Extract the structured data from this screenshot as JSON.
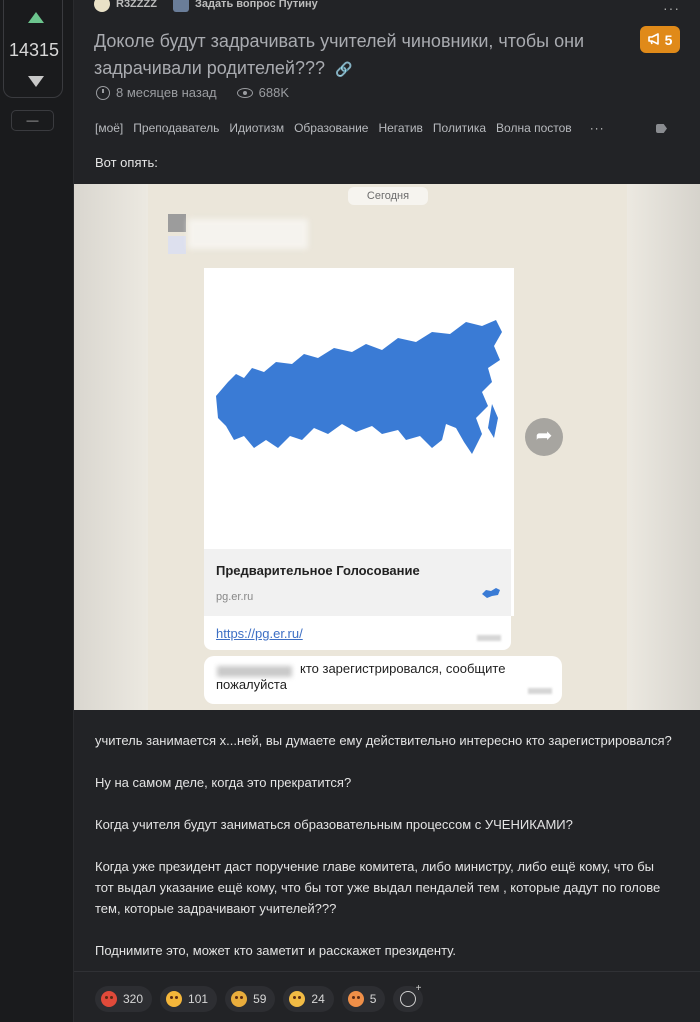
{
  "vote": {
    "count": "14315",
    "mini_label": "—"
  },
  "header": {
    "author": "R3ZZZZ",
    "community": "Задать вопрос Путину",
    "more": "···"
  },
  "badge": {
    "count": "5",
    "color": "#e08a19"
  },
  "post": {
    "title": "Доколе будут задрачивать учителей чиновники, чтобы они задрачивали родителей???",
    "time": "8 месяцев назад",
    "views": "688K",
    "tags": [
      "[моё]",
      "Преподаватель",
      "Идиотизм",
      "Образование",
      "Негатив",
      "Политика",
      "Волна постов"
    ],
    "tags_more": "···",
    "intro": "Вот опять:"
  },
  "screenshot": {
    "day_label": "Сегодня",
    "preview_title": "Предварительное Голосование",
    "preview_site": "pg.er.ru",
    "link": "https://pg.er.ru/",
    "message": "кто зарегистрировался, сообщите пожалуйста",
    "map_color": "#3a7bd5"
  },
  "body": [
    "учитель занимается х...ней, вы думаете ему действительно интересно кто зарегистрировался?",
    "Ну на самом деле, когда это прекратится?",
    "Когда учителя будут заниматься образовательным процессом с УЧЕНИКАМИ?",
    "Когда уже президент даст поручение главе комитета, либо министру, либо ещё кому, что бы тот выдал указание ещё кому, что бы тот уже выдал пендалей тем , которые дадут по голове тем, которые задрачивают учителей???",
    "Поднимите это, может кто заметит и расскажет президенту."
  ],
  "reactions": [
    {
      "icon": "angry-face-icon",
      "count": "320"
    },
    {
      "icon": "laughing-face-icon",
      "count": "101"
    },
    {
      "icon": "sad-face-icon",
      "count": "59"
    },
    {
      "icon": "cool-face-icon",
      "count": "24"
    },
    {
      "icon": "shocked-face-icon",
      "count": "5"
    }
  ]
}
